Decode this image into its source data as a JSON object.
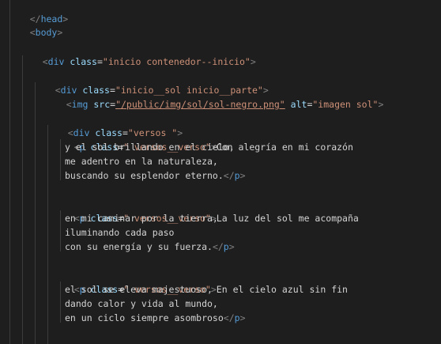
{
  "editor": {
    "colors": {
      "background": "#1e1e1e",
      "tag": "#569cd6",
      "attr": "#9cdcfe",
      "value": "#ce9178",
      "text": "#d4d4d4",
      "bracket": "#808080"
    },
    "lines": [
      {
        "close_tag": "head"
      },
      {
        "open_tag": "body"
      },
      {
        "open_tag": "div",
        "attr": "class",
        "value": "\"inicio contenedor--inicio\""
      },
      {
        "open_tag": "div",
        "attr": "class",
        "value": "\"inicio__sol inicio__parte\""
      },
      {
        "img_src": "\"/public/img/sol/sol-negro.png\"",
        "img_alt": "\"imagen sol\""
      },
      {
        "open_tag": "div",
        "attr": "class",
        "value": "\"versos \""
      },
      {
        "p_class": "\" versos__verso\"",
        "text": "Con alegría en mi corazón"
      },
      {
        "text": "y el sol brillando en el cielo,"
      },
      {
        "text": "me adentro en la naturaleza,"
      },
      {
        "text": "buscando su esplendor eterno."
      },
      {
        "p_class": "\" versos__verso\"",
        "text": "La luz del sol me acompaña"
      },
      {
        "text": "en mi caminar por la tierra,"
      },
      {
        "text": "iluminando cada paso"
      },
      {
        "text": "con su energía y su fuerza."
      },
      {
        "p_class": "\" versos__verso\"",
        "text": "En el cielo azul sin fin"
      },
      {
        "text": "el sol se eleva majestuoso,"
      },
      {
        "text": "dando calor y vida al mundo,"
      },
      {
        "text": "en un ciclo siempre asombroso"
      }
    ]
  }
}
